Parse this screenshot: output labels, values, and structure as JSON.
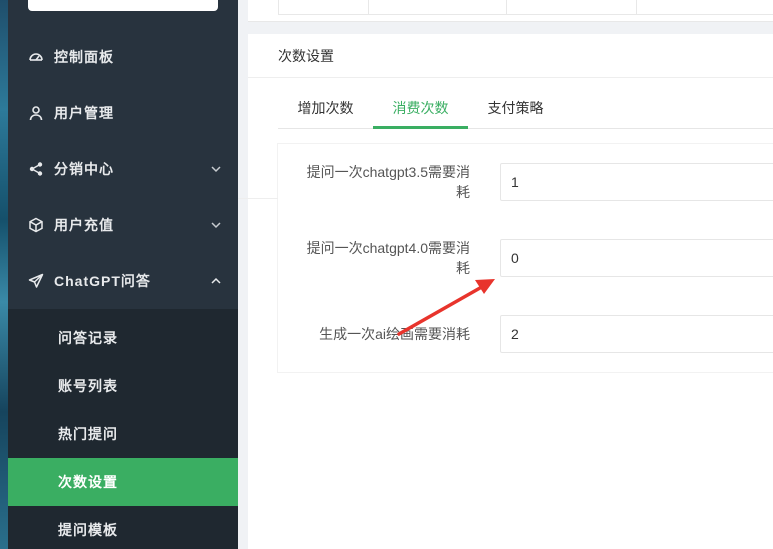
{
  "sidebar": {
    "items": [
      {
        "label": "控制面板",
        "icon": "gauge-icon"
      },
      {
        "label": "用户管理",
        "icon": "user-icon"
      },
      {
        "label": "分销中心",
        "icon": "share-icon"
      },
      {
        "label": "用户充值",
        "icon": "cube-icon"
      },
      {
        "label": "ChatGPT问答",
        "icon": "send-icon"
      }
    ],
    "submenu": [
      {
        "label": "问答记录"
      },
      {
        "label": "账号列表"
      },
      {
        "label": "热门提问"
      },
      {
        "label": "次数设置"
      },
      {
        "label": "提问模板"
      }
    ]
  },
  "card": {
    "title": "次数设置",
    "tabs": [
      {
        "label": "增加次数"
      },
      {
        "label": "消费次数"
      },
      {
        "label": "支付策略"
      }
    ],
    "active_tab": "消费次数",
    "fields": [
      {
        "label_line1": "提问一次chatgpt3.5需要消",
        "label_line2": "耗",
        "value": "1"
      },
      {
        "label_line1": "提问一次chatgpt4.0需要消",
        "label_line2": "耗",
        "value": "0"
      },
      {
        "label_line1": "生成一次ai绘画需要消耗",
        "label_line2": "",
        "value": "2"
      }
    ]
  },
  "colors": {
    "accent": "#3aae62",
    "sidebar_bg": "#28333e",
    "submenu_bg": "#1f2830",
    "annotation_arrow": "#e8342c"
  }
}
